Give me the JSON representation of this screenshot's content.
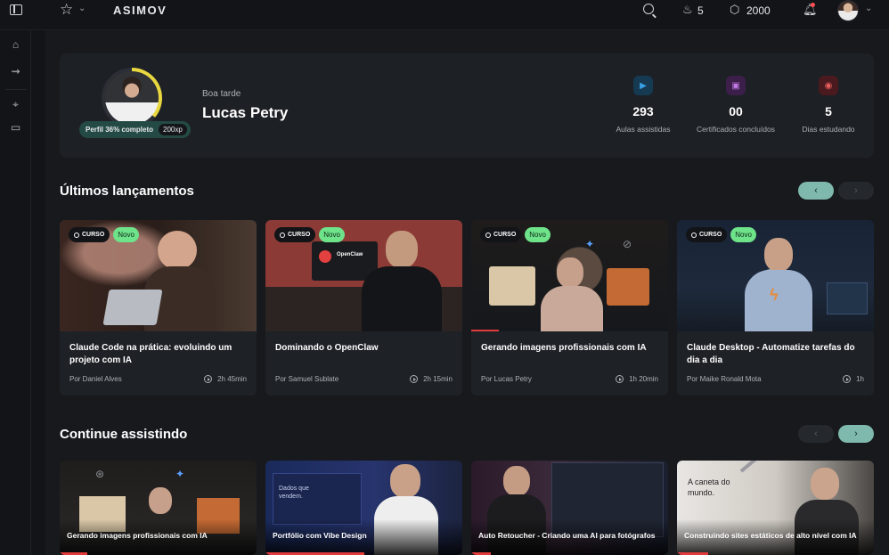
{
  "app": {
    "brand": "ASIMOV"
  },
  "topbar": {
    "streak_value": "5",
    "coins_value": "2000"
  },
  "profile": {
    "greeting": "Boa tarde",
    "name": "Lucas Petry",
    "completion_label": "Perfil 36% completo",
    "completion_fraction": 0.36,
    "xp_label": "200xp"
  },
  "stats": [
    {
      "value": "293",
      "label": "Aulas assistidas",
      "icon": "play-circle-icon",
      "color": "#2a8fd6"
    },
    {
      "value": "00",
      "label": "Certificados concluídos",
      "icon": "certificate-icon",
      "color": "#b56ad8"
    },
    {
      "value": "5",
      "label": "Dias estudando",
      "icon": "fire-icon",
      "color": "#e05252"
    }
  ],
  "sections": {
    "latest_title": "Últimos lançamentos",
    "continue_title": "Continue assistindo"
  },
  "badges": {
    "course": "CURSO",
    "new": "Novo"
  },
  "latest": [
    {
      "title": "Claude Code na prática: evoluindo um projeto com IA",
      "author": "Por Daniel Alves",
      "duration": "2h 45min",
      "progress": 0
    },
    {
      "title": "Dominando o OpenClaw",
      "author": "Por Samuel Sublate",
      "duration": "2h 15min",
      "progress": 0,
      "thumb_text": "OpenClaw"
    },
    {
      "title": "Gerando imagens profissionais com IA",
      "author": "Por Lucas Petry",
      "duration": "1h 20min",
      "progress": 0.14
    },
    {
      "title": "Claude Desktop - Automatize tarefas do dia a dia",
      "author": "Por Maike Ronald Mota",
      "duration": "1h",
      "progress": 0
    }
  ],
  "continue": [
    {
      "title": "Gerando imagens profissionais com IA",
      "progress": 0.14
    },
    {
      "title": "Portfólio com Vibe Design",
      "progress": 0.5,
      "thumb_text": "Dados que vendem."
    },
    {
      "title": "Auto Retoucher - Criando uma AI para fotógrafos",
      "progress": 0.1
    },
    {
      "title": "Construindo sites estáticos de alto nível com IA",
      "progress": 0.16,
      "thumb_text": "A caneta do mundo."
    }
  ],
  "colors": {
    "accent": "#7fb9ad",
    "new_badge": "#6ee38a",
    "progress": "#e23b3b",
    "ring": "#e9d73f"
  }
}
